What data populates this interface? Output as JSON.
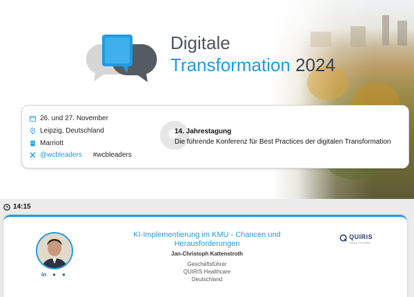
{
  "hero": {
    "title_line1": "Digitale",
    "title_line2": "Transformation",
    "title_year": "2024",
    "colors": {
      "accent": "#1f9be0",
      "dark": "#4a5560"
    }
  },
  "info": {
    "date": "26. und 27. November",
    "location": "Leipzig, Deutschland",
    "venue": "Marriott",
    "handle": "@wcbleaders",
    "hashtag": "#wcbleaders",
    "edition": "14. Jahrestagung",
    "tagline": "Die führende Konferenz für Best Practices der digitalen Transformation",
    "icons": [
      "calendar-icon",
      "location-pin-icon",
      "building-icon",
      "x-logo-icon"
    ]
  },
  "session": {
    "time": "14:15",
    "title": "KI-Implementierung im KMU - Chancen und Herausforderungen",
    "speaker": "Jan-Christoph Kattenstroth",
    "role": "Geschäftsführer",
    "company": "QUIRIS Healthcare",
    "country": "Deutschland",
    "company_logo_name": "QUIRIS",
    "company_logo_sub": "HEALTHCARE",
    "social_links": [
      "in",
      "xing",
      "chat"
    ]
  }
}
